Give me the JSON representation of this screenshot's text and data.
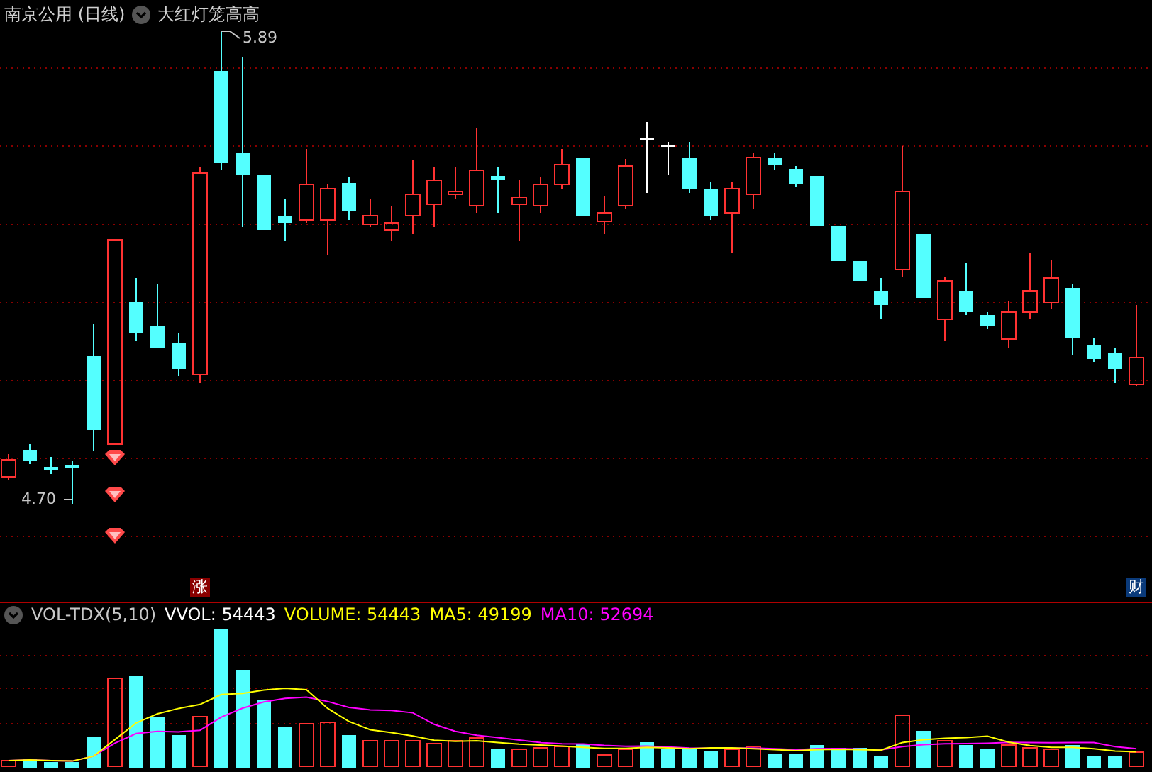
{
  "header": {
    "title": "南京公用 (日线)",
    "indicator": "大红灯笼高高"
  },
  "price_chart": {
    "high_label": "5.89",
    "low_label": "4.70"
  },
  "badges": [
    {
      "text": "涨",
      "color": "#8b0000"
    },
    {
      "text": "财",
      "color": "#0a3a7a"
    }
  ],
  "volume_legend": [
    {
      "text": "VOL-TDX(5,10)",
      "color": "#c8c8c8"
    },
    {
      "text": "VVOL: 54443",
      "color": "#ffffff"
    },
    {
      "text": "VOLUME: 54443",
      "color": "#ffff00"
    },
    {
      "text": "MA5: 49199",
      "color": "#ffff00"
    },
    {
      "text": "MA10: 52694",
      "color": "#ff00ff"
    }
  ]
}
